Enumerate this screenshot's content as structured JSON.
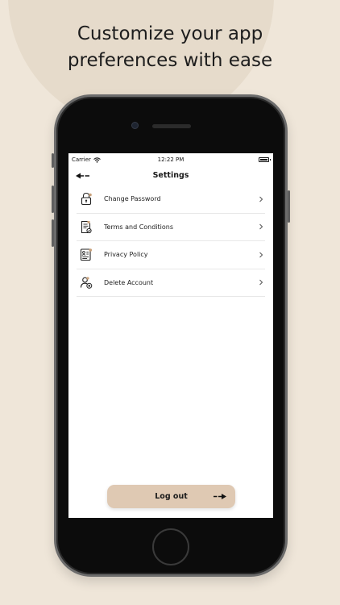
{
  "promo": {
    "headline_line1": "Customize your app",
    "headline_line2": "preferences with ease"
  },
  "statusbar": {
    "carrier": "Carrier",
    "time": "12:22 PM"
  },
  "navbar": {
    "title": "Settings",
    "back_icon": "back-arrow-icon"
  },
  "menu": {
    "items": [
      {
        "label": "Change Password",
        "icon": "lock-icon"
      },
      {
        "label": "Terms and Conditions",
        "icon": "document-icon"
      },
      {
        "label": "Privacy Policy",
        "icon": "id-card-icon"
      },
      {
        "label": "Delete Account",
        "icon": "user-remove-icon"
      }
    ]
  },
  "logout": {
    "label": "Log out",
    "icon": "logout-arrow-icon"
  },
  "colors": {
    "background": "#efe6d9",
    "accent": "#dfc9b3",
    "icon_accent": "#c9a27c"
  }
}
